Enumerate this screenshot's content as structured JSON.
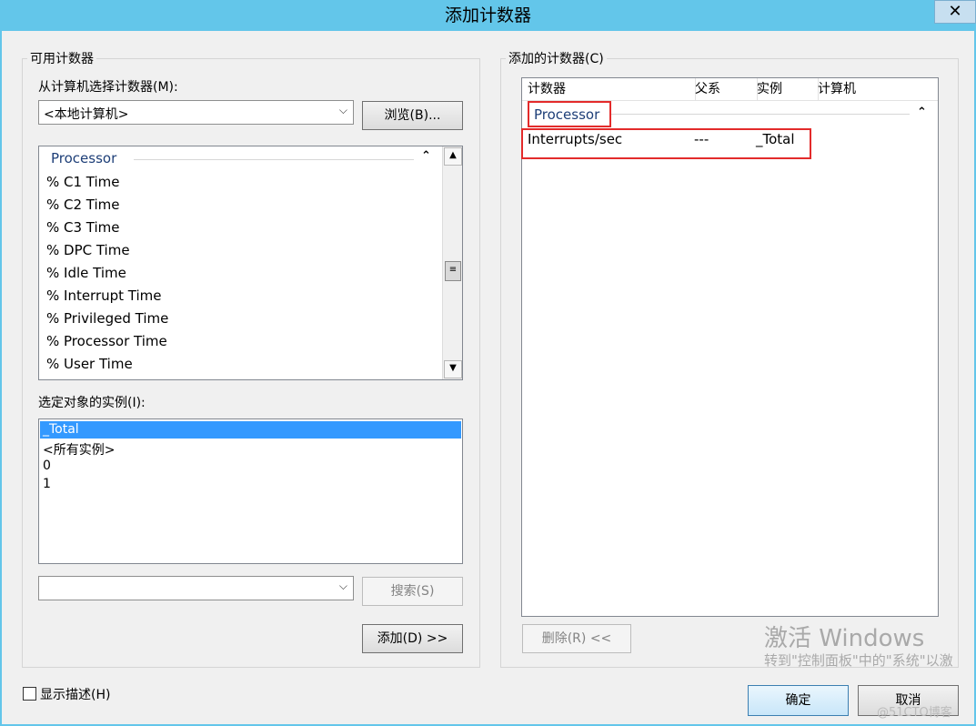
{
  "window": {
    "title": "添加计数器",
    "close": "✕"
  },
  "left": {
    "group_label": "可用计数器",
    "select_label": "从计算机选择计数器(M):",
    "computer_value": "<本地计算机>",
    "browse_label": "浏览(B)...",
    "category": "Processor",
    "counters": [
      "% C1 Time",
      "% C2 Time",
      "% C3 Time",
      "% DPC Time",
      "% Idle Time",
      "% Interrupt Time",
      "% Privileged Time",
      "% Processor Time",
      "% User Time"
    ],
    "instances_label": "选定对象的实例(I):",
    "instances": [
      "_Total",
      "<所有实例>",
      "0",
      "1"
    ],
    "selected_instance": "_Total",
    "search_value": "",
    "search_label": "搜索(S)",
    "add_label": "添加(D) >>"
  },
  "right": {
    "group_label": "添加的计数器(C)",
    "columns": [
      "计数器",
      "父系",
      "实例",
      "计算机"
    ],
    "category": "Processor",
    "row": {
      "counter": "Interrupts/sec",
      "parent": "---",
      "instance": "_Total",
      "computer": ""
    },
    "remove_label": "删除(R) <<"
  },
  "footer": {
    "show_desc_label": "显示描述(H)",
    "ok_label": "确定",
    "cancel_label": "取消"
  },
  "watermark": {
    "activate_title": "激活 Windows",
    "activate_sub": "转到\"控制面板\"中的\"系统\"以激",
    "blog": "@51CTO博客"
  }
}
